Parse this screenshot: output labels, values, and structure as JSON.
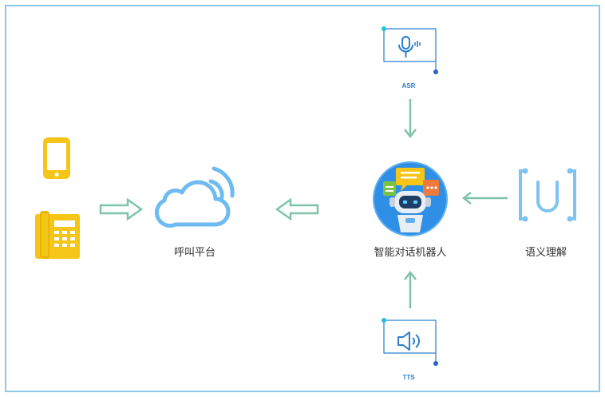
{
  "nodes": {
    "call_platform": {
      "label": "呼叫平台"
    },
    "robot": {
      "label": "智能对话机器人"
    },
    "nlu": {
      "label": "语义理解"
    },
    "asr": {
      "label": "ASR"
    },
    "tts": {
      "label": "TTS"
    }
  },
  "colors": {
    "frame": "#8cc8ec",
    "device_yellow": "#f5c518",
    "cloud_blue": "#6dbbf2",
    "arrow_green": "#7fc4a8",
    "box_blue": "#2a7fcf",
    "robot_circle": "#2f8fe6"
  },
  "icons": {
    "phone": "smartphone-icon",
    "desk_phone": "desk-phone-icon",
    "cloud": "cloud-icon",
    "microphone": "microphone-icon",
    "speaker": "speaker-icon",
    "nlu": "u-bracket-icon",
    "robot": "robot-icon"
  }
}
